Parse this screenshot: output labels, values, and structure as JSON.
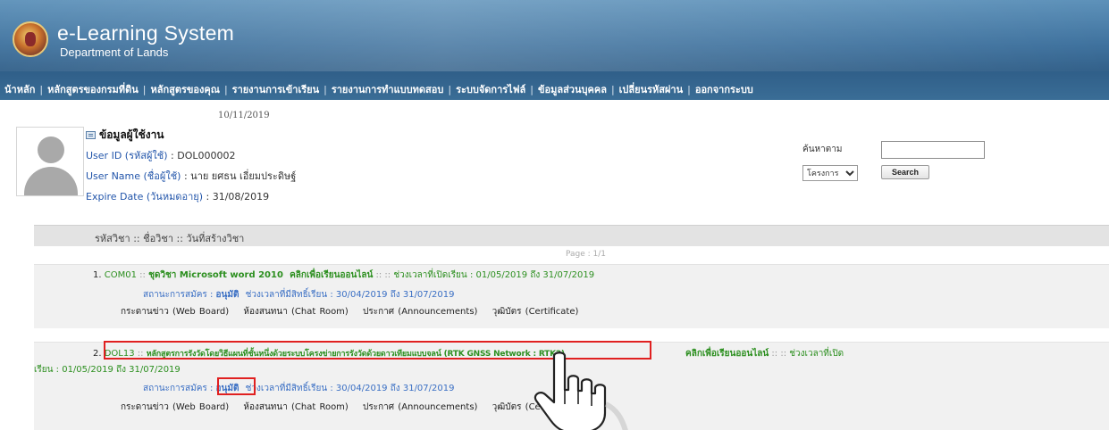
{
  "header": {
    "title": "e-Learning System",
    "subtitle": "Department of Lands"
  },
  "nav": {
    "items": [
      {
        "label": "น้าหลัก"
      },
      {
        "label": "หลักสูตรของกรมที่ดิน"
      },
      {
        "label": "หลักสูตรของคุณ"
      },
      {
        "label": "รายงานการเข้าเรียน"
      },
      {
        "label": "รายงานการทำแบบทดสอบ"
      },
      {
        "label": "ระบบจัดการไฟล์"
      },
      {
        "label": "ข้อมูลส่วนบุคคล"
      },
      {
        "label": "เปลี่ยนรหัสผ่าน"
      },
      {
        "label": "ออกจากระบบ"
      }
    ]
  },
  "user": {
    "date": "10/11/2019",
    "section_title": "ข้อมูลผู้ใช้งาน",
    "id_label": "User ID (รหัสผู้ใช้)",
    "id_value": ": DOL000002",
    "name_label": "User Name (ชื่อผู้ใช้)",
    "name_value": ": นาย ยศธน  เอี่ยมประดิษฐ์",
    "expire_label": "Expire Date (วันหมดอายุ)",
    "expire_value": ": 31/08/2019"
  },
  "search": {
    "label": "ค้นหาตาม",
    "input_value": "",
    "select_value": "โครงการ",
    "button_label": "Search"
  },
  "list": {
    "header": "รหัสวิชา :: ชื่อวิชา :: วันที่สร้างวิชา",
    "page": "Page : 1/1",
    "courses": [
      {
        "num": "1.",
        "code": "COM01",
        "sep": "::",
        "name": "ชุดวิชา Microsoft word 2010",
        "online": "คลิกเพื่อเรียนออนไลน์",
        "sep2": ":: ::",
        "period_label": "ช่วงเวลาที่เปิดเรียน",
        "period_value": ": 01/05/2019 ถึง 31/07/2019",
        "status_label": "สถานะการสมัคร :",
        "status_value": "อนุมัติ",
        "right_label": "ช่วงเวลาที่มีสิทธิ์เรียน",
        "right_value": ": 30/04/2019 ถึง 31/07/2019",
        "links": [
          "กระดานข่าว (Web Board)",
          "ห้องสนทนา (Chat Room)",
          "ประกาศ (Announcements)",
          "วุฒิบัตร (Certificate)"
        ]
      },
      {
        "num": "2.",
        "code": "DOL13",
        "sep": "::",
        "name": "หลักสูตรการรังวัดโดยวิธีแผนที่ชั้นหนึ่งด้วยระบบโครงข่ายการรังวัดด้วยดาวเทียมแบบจลน์ (RTK GNSS Network : RTK2)",
        "online": "คลิกเพื่อเรียนออนไลน์",
        "sep2": ":: ::",
        "period_label": "ช่วงเวลาที่เปิด",
        "period_cont": "เรียน : 01/05/2019 ถึง 31/07/2019",
        "status_label": "สถานะการสมัคร :",
        "status_value": "อนุมัติ",
        "right_label": "ช่วงเวลาที่มีสิทธิ์เรียน",
        "right_value": ": 30/04/2019 ถึง 31/07/2019",
        "links": [
          "กระดานข่าว (Web Board)",
          "ห้องสนทนา (Chat Room)",
          "ประกาศ (Announcements)",
          "วุฒิบัตร (Certificate)"
        ]
      }
    ]
  },
  "colors": {
    "header": "#3b6f9c",
    "course_green": "#2c8f1f",
    "link_blue": "#3a6fc4",
    "highlight_red": "#e02020"
  },
  "icons": [
    "seal-logo-icon",
    "id-card-icon",
    "hand-pointer-icon"
  ]
}
